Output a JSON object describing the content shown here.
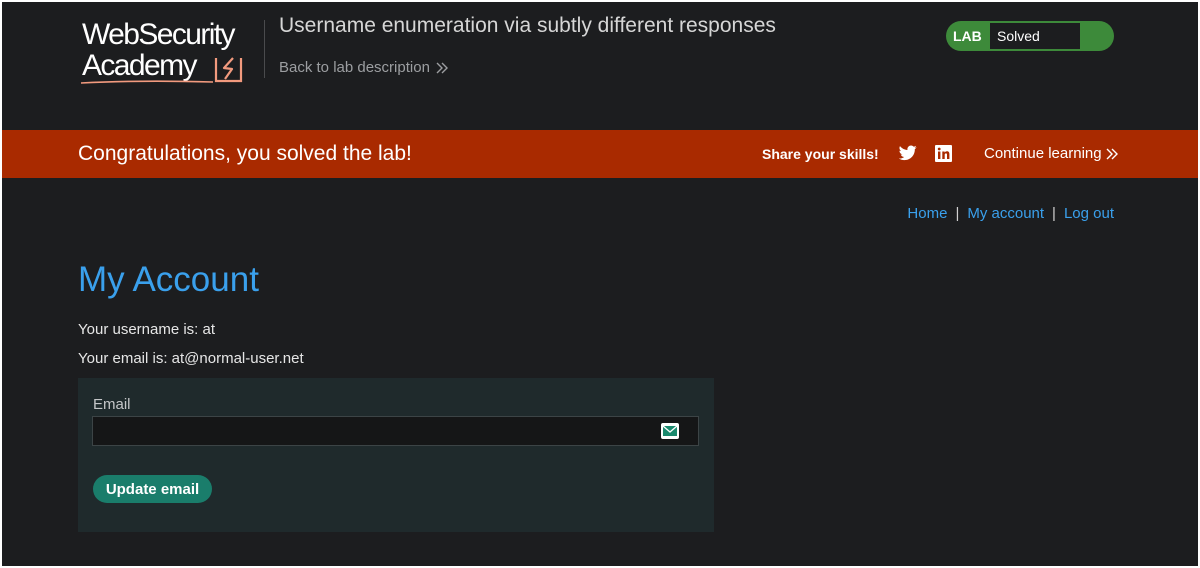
{
  "logo": {
    "line1": "WebSecurity",
    "line2": "Academy"
  },
  "header": {
    "lab_title": "Username enumeration via subtly different responses",
    "back_link": "Back to lab description",
    "lab_tag": "LAB",
    "status": "Solved",
    "status_color": "#3d8a3a"
  },
  "banner": {
    "message": "Congratulations, you solved the lab!",
    "share": "Share your skills!",
    "continue": "Continue learning",
    "icons": [
      "twitter-icon",
      "linkedin-icon"
    ],
    "background": "#a92a00"
  },
  "nav": {
    "home": "Home",
    "my_account": "My account",
    "log_out": "Log out",
    "separator": "|"
  },
  "main": {
    "heading": "My Account",
    "username_line": "Your username is: at",
    "email_line": "Your email is: at@normal-user.net",
    "form": {
      "email_label": "Email",
      "email_value": "",
      "button": "Update email"
    }
  },
  "colors": {
    "link": "#3aa0ec",
    "button": "#1a7d6b",
    "page_bg": "#1c1d1f"
  }
}
